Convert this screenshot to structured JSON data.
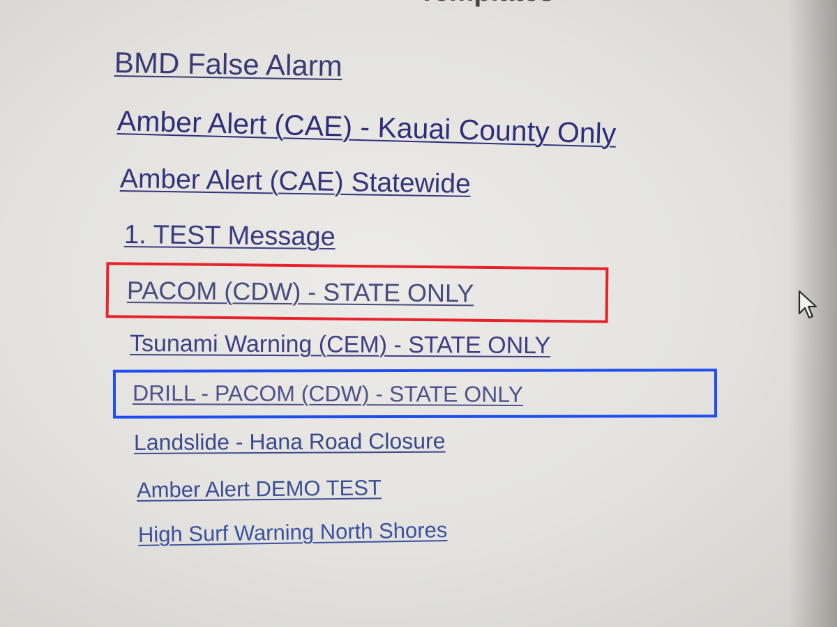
{
  "page": {
    "heading": "Templates"
  },
  "templates": [
    {
      "label": "BMD False Alarm"
    },
    {
      "label": "Amber Alert (CAE) - Kauai County Only"
    },
    {
      "label": "Amber Alert (CAE) Statewide"
    },
    {
      "label": "1. TEST Message"
    },
    {
      "label": "PACOM (CDW) - STATE ONLY"
    },
    {
      "label": "Tsunami Warning (CEM) - STATE ONLY"
    },
    {
      "label": "DRILL - PACOM (CDW) - STATE ONLY"
    },
    {
      "label": "Landslide - Hana Road Closure"
    },
    {
      "label": "Amber Alert DEMO TEST"
    },
    {
      "label": "High Surf Warning North Shores"
    }
  ],
  "highlights": {
    "red": {
      "color": "#e8222a",
      "target_index": 4
    },
    "blue": {
      "color": "#1f4ef0",
      "target_index": 6
    }
  },
  "cursor": {
    "icon": "mouse-pointer-icon"
  }
}
